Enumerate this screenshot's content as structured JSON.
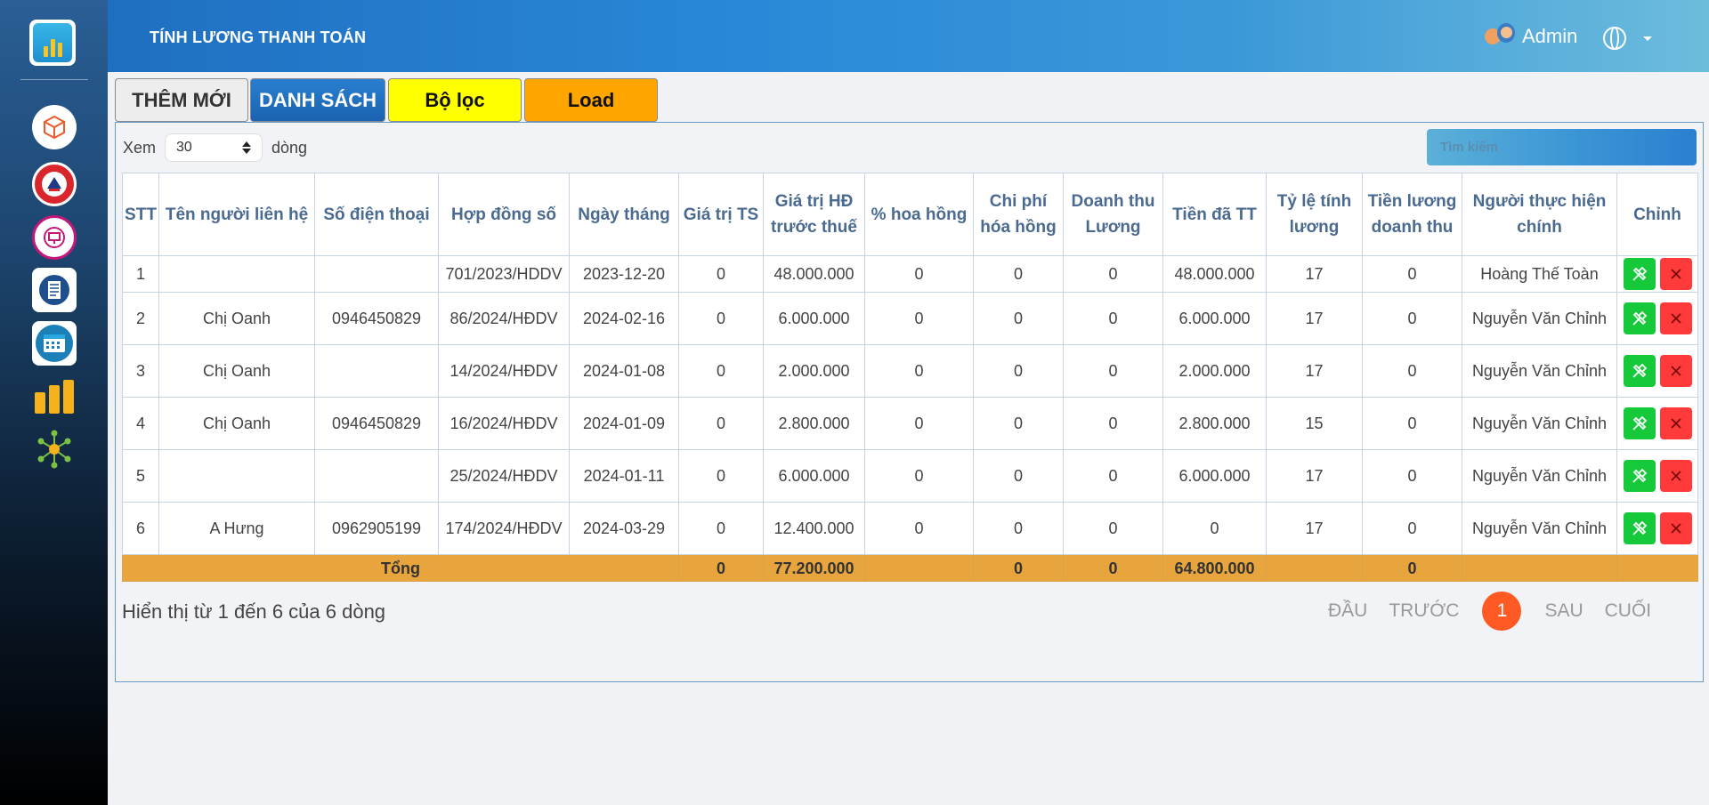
{
  "header": {
    "title": "TÍNH LƯƠNG THANH TOÁN",
    "user_name": "Admin"
  },
  "tabs": {
    "add": "THÊM MỚI",
    "list": "DANH SÁCH",
    "filter": "Bộ lọc",
    "load": "Load"
  },
  "length": {
    "prefix": "Xem",
    "value": "30",
    "suffix": "dòng"
  },
  "search": {
    "placeholder": "Tìm kiếm"
  },
  "table": {
    "headers": [
      "STT",
      "Tên người liên hệ",
      "Số điện thoại",
      "Hợp đồng số",
      "Ngày tháng",
      "Giá trị TS",
      "Giá trị HĐ trước thuế",
      "% hoa hồng",
      "Chi phí hóa hồng",
      "Doanh thu Lương",
      "Tiền đã TT",
      "Tỷ lệ tính lương",
      "Tiền lương doanh thu",
      "Người thực hiện chính",
      "Chỉnh"
    ],
    "rows": [
      [
        "1",
        "",
        "",
        "701/2023/HDDV",
        "2023-12-20",
        "0",
        "48.000.000",
        "0",
        "0",
        "0",
        "48.000.000",
        "17",
        "0",
        "Hoàng Thế Toàn"
      ],
      [
        "2",
        "Chị Oanh",
        "0946450829",
        "86/2024/HĐDV",
        "2024-02-16",
        "0",
        "6.000.000",
        "0",
        "0",
        "0",
        "6.000.000",
        "17",
        "0",
        "Nguyễn Văn Chỉnh"
      ],
      [
        "3",
        "Chị Oanh",
        "",
        "14/2024/HĐDV",
        "2024-01-08",
        "0",
        "2.000.000",
        "0",
        "0",
        "0",
        "2.000.000",
        "17",
        "0",
        "Nguyễn Văn Chỉnh"
      ],
      [
        "4",
        "Chị Oanh",
        "0946450829",
        "16/2024/HĐDV",
        "2024-01-09",
        "0",
        "2.800.000",
        "0",
        "0",
        "0",
        "2.800.000",
        "15",
        "0",
        "Nguyễn Văn Chỉnh"
      ],
      [
        "5",
        "",
        "",
        "25/2024/HĐDV",
        "2024-01-11",
        "0",
        "6.000.000",
        "0",
        "0",
        "0",
        "6.000.000",
        "17",
        "0",
        "Nguyễn Văn Chỉnh"
      ],
      [
        "6",
        "A Hưng",
        "0962905199",
        "174/2024/HĐDV",
        "2024-03-29",
        "0",
        "12.400.000",
        "0",
        "0",
        "0",
        "0",
        "17",
        "0",
        "Nguyễn Văn Chỉnh"
      ]
    ],
    "total": {
      "label": "Tổng",
      "gia_tri_ts": "0",
      "gia_tri_hd": "77.200.000",
      "hoa_hong": "",
      "chi_phi": "0",
      "doanh_thu": "0",
      "tien_da_tt": "64.800.000",
      "ty_le": "",
      "tien_luong": "0"
    }
  },
  "footer": {
    "info": "Hiển thị từ 1 đến 6 của 6 dòng",
    "pager": {
      "first": "ĐẦU",
      "prev": "TRƯỚC",
      "current": "1",
      "next": "SAU",
      "last": "CUỐI"
    }
  },
  "colors": {
    "edit_button": "#16c93a",
    "delete_button": "#ff3a3a",
    "total_row": "#e8a53e",
    "active_page": "#ff5a24"
  },
  "icons": {
    "sidebar": [
      "box-icon",
      "school-emblem-icon",
      "presentation-badge-icon",
      "document-icon",
      "calendar-icon",
      "bar-chart-icon",
      "network-icon"
    ],
    "row_actions": [
      "edit-tools-icon",
      "delete-x-icon"
    ]
  }
}
